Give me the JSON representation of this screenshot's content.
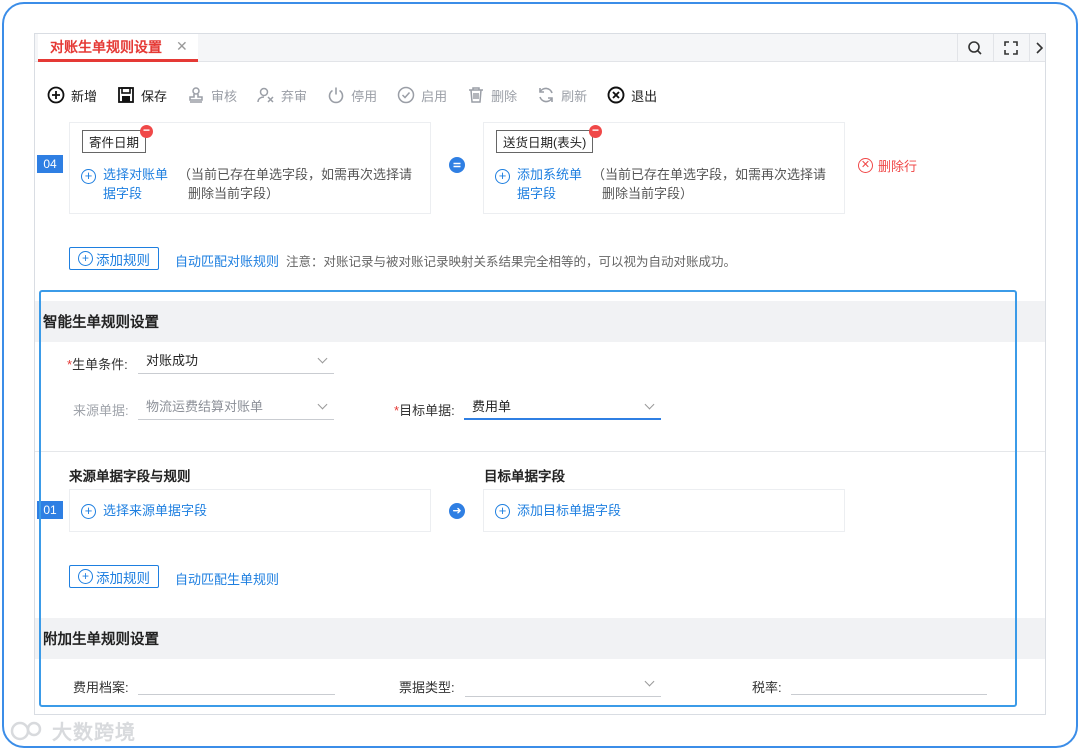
{
  "tab": {
    "title": "对账生单规则设置"
  },
  "toolbar": {
    "items": [
      {
        "label": "新增",
        "icon": "plus-circle-icon",
        "enabled": true
      },
      {
        "label": "保存",
        "icon": "save-icon",
        "enabled": true
      },
      {
        "label": "审核",
        "icon": "stamp-icon",
        "enabled": false
      },
      {
        "label": "弃审",
        "icon": "user-cancel-icon",
        "enabled": false
      },
      {
        "label": "停用",
        "icon": "power-icon",
        "enabled": false
      },
      {
        "label": "启用",
        "icon": "check-circle-icon",
        "enabled": false
      },
      {
        "label": "删除",
        "icon": "trash-icon",
        "enabled": false
      },
      {
        "label": "刷新",
        "icon": "refresh-icon",
        "enabled": false
      },
      {
        "label": "退出",
        "icon": "exit-icon",
        "enabled": true
      }
    ]
  },
  "rule04": {
    "num": "04",
    "left_tag": "寄件日期",
    "left_add": "选择对账单据字段",
    "left_add_l1": "选择对账单",
    "left_add_l2": "据字段",
    "left_hint_l1": "（当前已存在单选字段，如需再次选择请",
    "left_hint_l2": "删除当前字段）",
    "right_tag": "送货日期(表头)",
    "right_add_l1": "添加系统单",
    "right_add_l2": "据字段",
    "right_hint_l1": "（当前已存在单选字段，如需再次选择请",
    "right_hint_l2": "删除当前字段）",
    "delete_row": "删除行"
  },
  "recon_footer": {
    "add_rule": "添加规则",
    "auto_match": "自动匹配对账规则",
    "note": "注意：对账记录与被对账记录映射关系结果完全相等的，可以视为自动对账成功。"
  },
  "smart": {
    "title": "智能生单规则设置",
    "condition_label": "生单条件:",
    "condition_value": "对账成功",
    "source_label": "来源单据:",
    "source_value": "物流运费结算对账单",
    "target_label": "目标单据:",
    "target_value": "费用单",
    "src_col_title": "来源单据字段与规则",
    "tgt_col_title": "目标单据字段",
    "row_num": "01",
    "src_add": "选择来源单据字段",
    "tgt_add": "添加目标单据字段",
    "add_rule": "添加规则",
    "auto_match": "自动匹配生单规则"
  },
  "extra": {
    "title": "附加生单规则设置",
    "fee_label": "费用档案:",
    "bill_type_label": "票据类型:",
    "tax_label": "税率:"
  },
  "watermark": "大数跨境"
}
